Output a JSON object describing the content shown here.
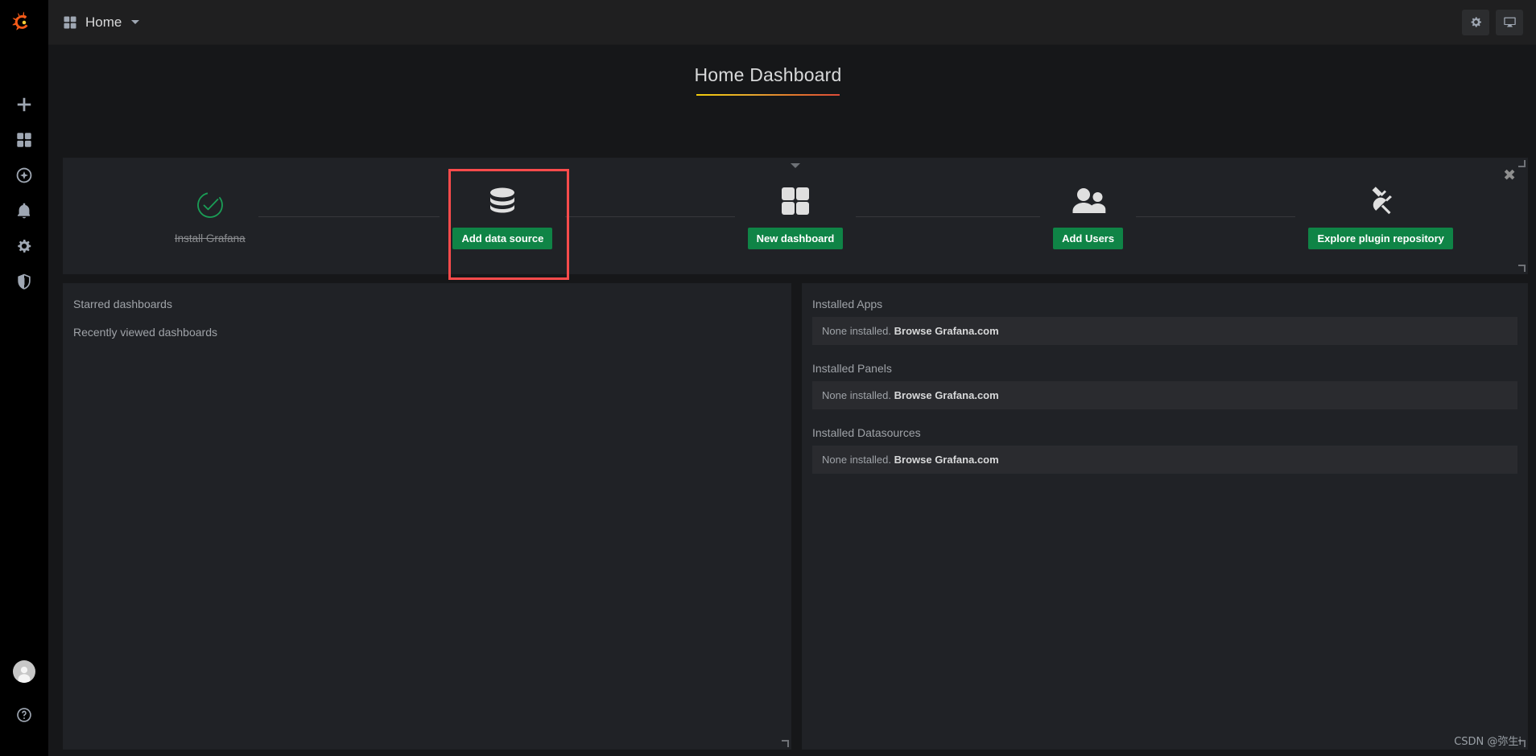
{
  "sidemenu": {
    "brand_icon": "grafana-logo-icon",
    "items": [
      {
        "name": "create",
        "icon": "plus-icon"
      },
      {
        "name": "dashboards",
        "icon": "grid-icon"
      },
      {
        "name": "explore",
        "icon": "compass-icon"
      },
      {
        "name": "alerting",
        "icon": "bell-icon"
      },
      {
        "name": "configuration",
        "icon": "gear-icon"
      },
      {
        "name": "server-admin",
        "icon": "shield-icon"
      }
    ],
    "bottom": [
      {
        "name": "user-profile",
        "icon": "user-avatar-icon"
      },
      {
        "name": "help",
        "icon": "question-circle-icon"
      }
    ]
  },
  "navbar": {
    "breadcrumb_icon": "grid-icon",
    "breadcrumb_label": "Home",
    "caret_icon": "caret-down-icon",
    "actions": [
      {
        "name": "dashboard-settings",
        "icon": "gear-icon"
      },
      {
        "name": "kiosk-mode",
        "icon": "monitor-icon"
      }
    ]
  },
  "dashboard": {
    "title": "Home Dashboard"
  },
  "onboarding": {
    "collapse_icon": "caret-down-icon",
    "close_label": "✖",
    "steps": [
      {
        "name": "install-grafana",
        "icon": "check-circle-icon",
        "label": "Install Grafana",
        "done": true
      },
      {
        "name": "add-data-source",
        "icon": "database-icon",
        "label": "Add data source",
        "done": false,
        "highlighted": true
      },
      {
        "name": "new-dashboard",
        "icon": "grid-icon",
        "label": "New dashboard",
        "done": false
      },
      {
        "name": "add-users",
        "icon": "users-icon",
        "label": "Add Users",
        "done": false
      },
      {
        "name": "explore-plugin-repository",
        "icon": "plug-icon",
        "label": "Explore plugin repository",
        "done": false
      }
    ],
    "highlight_color": "#fc4b4b",
    "button_color": "#0f8446"
  },
  "panel_left": {
    "rows": [
      {
        "name": "starred-dashboards",
        "label": "Starred dashboards"
      },
      {
        "name": "recently-viewed-dashboards",
        "label": "Recently viewed dashboards"
      }
    ]
  },
  "panel_right": {
    "sections": [
      {
        "name": "installed-apps",
        "heading": "Installed Apps",
        "empty_text": "None installed.",
        "link_label": "Browse Grafana.com"
      },
      {
        "name": "installed-panels",
        "heading": "Installed Panels",
        "empty_text": "None installed.",
        "link_label": "Browse Grafana.com"
      },
      {
        "name": "installed-datasources",
        "heading": "Installed Datasources",
        "empty_text": "None installed.",
        "link_label": "Browse Grafana.com"
      }
    ]
  },
  "watermark": "CSDN @弥生i"
}
